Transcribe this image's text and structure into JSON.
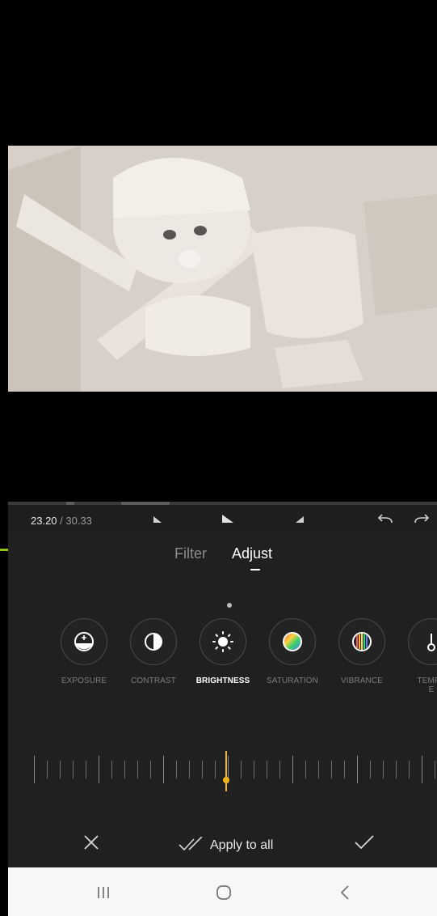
{
  "player": {
    "current_time": "23.20",
    "total_time": " / 30.33"
  },
  "tabs": {
    "filter": "Filter",
    "adjust": "Adjust"
  },
  "tools": [
    {
      "label": "EXPOSURE",
      "icon": "exposure-icon"
    },
    {
      "label": "CONTRAST",
      "icon": "contrast-icon"
    },
    {
      "label": "BRIGHTNESS",
      "icon": "brightness-icon"
    },
    {
      "label": "SATURATION",
      "icon": "saturation-icon"
    },
    {
      "label": "VIBRANCE",
      "icon": "vibrance-icon"
    },
    {
      "label": "TEMPE\nE",
      "icon": "temperature-icon"
    }
  ],
  "active_tool": "BRIGHTNESS",
  "actions": {
    "apply_to_all": "Apply to all"
  },
  "colors": {
    "accent": "#f0b41c",
    "annotation_arrow": "#8ec21f",
    "panel_bg": "#202020"
  }
}
